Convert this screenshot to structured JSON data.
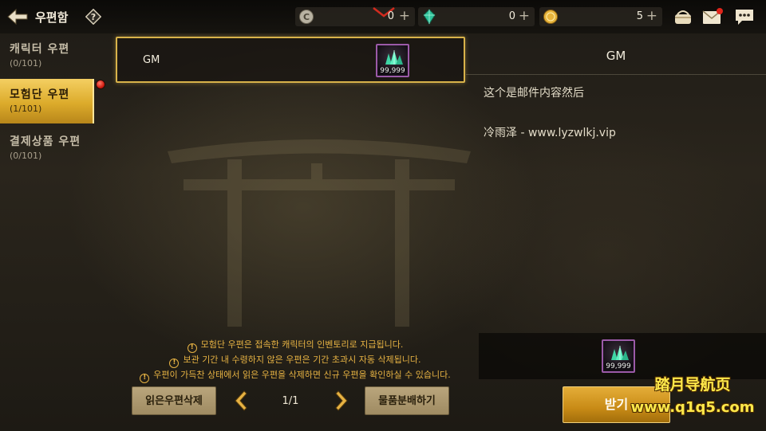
{
  "header": {
    "title": "우편함",
    "help_label": "?",
    "currencies": [
      {
        "icon": "silver-coin-icon",
        "value": "0"
      },
      {
        "icon": "green-crystal-icon",
        "value": "0"
      },
      {
        "icon": "gold-coin-icon",
        "value": "5"
      }
    ],
    "plus_label": "+"
  },
  "sidebar": {
    "tabs": [
      {
        "label": "캐릭터 우편",
        "count": "(0/101)",
        "active": false
      },
      {
        "label": "모험단 우편",
        "count": "(1/101)",
        "active": true
      },
      {
        "label": "결제상품 우편",
        "count": "(0/101)",
        "active": false
      }
    ]
  },
  "mail_list": [
    {
      "sender": "GM",
      "item_qty": "99,999",
      "selected": true
    }
  ],
  "detail": {
    "title": "GM",
    "body_lines": [
      "这个是邮件内容然后",
      "冷雨泽 - www.lyzwlkj.vip"
    ],
    "attachment_qty": "99,999"
  },
  "notices": [
    "모험단 우편은 접속한 캐릭터의 인벤토리로 지급됩니다.",
    "보관 기간 내 수령하지 않은 우편은 기간 초과시 자동 삭제됩니다.",
    "우편이 가득찬 상태에서 읽은 우편을 삭제하면 신규 우편을 확인하실 수 있습니다."
  ],
  "notice_icon": "!",
  "footer": {
    "delete_read_label": "읽은우편삭제",
    "page": "1/1",
    "disassemble_label": "물품분배하기",
    "receive_label": "받기"
  },
  "watermark": {
    "line1": "踏月导航页",
    "line2": "www.q1q5.com"
  },
  "colors": {
    "accent_gold": "#d8b24a",
    "notice_text": "#e6b243",
    "active_tab": "#dcab2b",
    "primary_button": "#c88b16"
  }
}
